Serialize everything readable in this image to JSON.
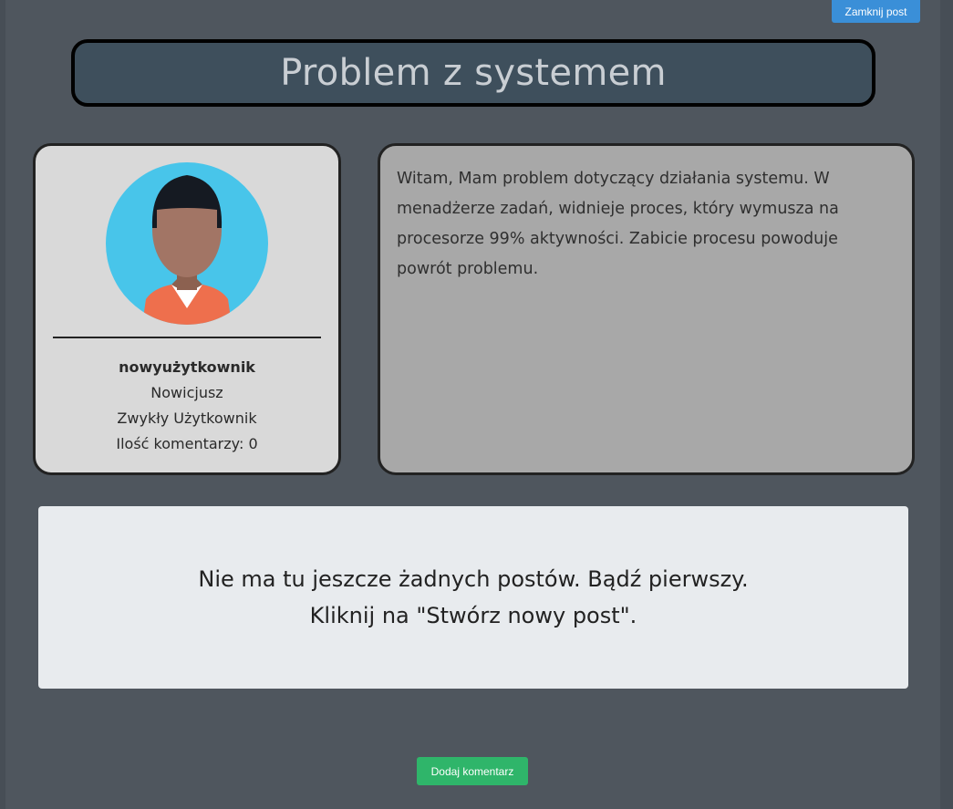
{
  "toolbar": {
    "close_post_label": "Zamknij post"
  },
  "post": {
    "title": "Problem z systemem",
    "body": "Witam, Mam problem dotyczący działania systemu. W menadżerze zadań, widnieje proces, który wymusza na procesorze 99% aktywności. Zabicie procesu powoduje powrót problemu."
  },
  "author": {
    "avatar_icon": "user-avatar-icon",
    "username": "nowyużytkownik",
    "rank": "Nowicjusz",
    "role": "Zwykły Użytkownik",
    "comment_count": "Ilość komentarzy: 0"
  },
  "comments": {
    "empty_line1": "Nie ma tu jeszcze żadnych postów. Bądź pierwszy.",
    "empty_line2": "Kliknij na \"Stwórz nowy post\"."
  },
  "actions": {
    "add_comment_label": "Dodaj komentarz"
  },
  "colors": {
    "close_button": "#3a8fd8",
    "add_button": "#2fb56a",
    "avatar_bg": "#48c5ea",
    "avatar_shirt": "#ee6f4d"
  }
}
